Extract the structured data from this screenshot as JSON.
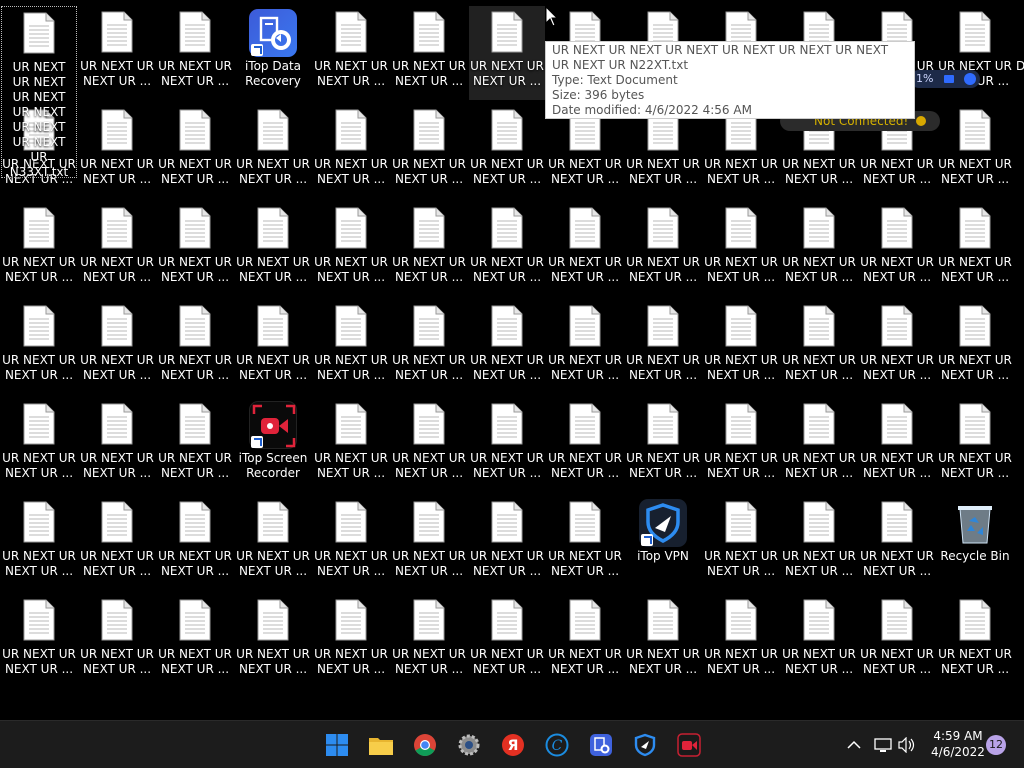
{
  "desktop": {
    "file_label": "UR NEXT UR NEXT UR ...",
    "selected_label": "UR NEXT UR NEXT UR NEXT UR NEXT UR NEXT UR NEXT UR N33XT.txt",
    "partial_label": "D",
    "apps": {
      "data_recovery": "iTop Data Recovery",
      "screen_recorder": "iTop Screen Recorder",
      "vpn": "iTop VPN",
      "recycle_bin": "Recycle Bin"
    }
  },
  "tooltip": {
    "name": "UR NEXT UR NEXT UR NEXT UR NEXT UR NEXT UR NEXT UR NEXT UR N22XT.txt",
    "type": "Type: Text Document",
    "size": "Size: 396 bytes",
    "modified": "Date modified: 4/6/2022 4:56 AM"
  },
  "overlays": {
    "status": "Not Connected!",
    "percent": "1%"
  },
  "taskbar": {
    "time": "4:59 AM",
    "date": "4/6/2022",
    "notifications": "12",
    "apps": [
      "windows-start",
      "file-explorer",
      "chrome",
      "settings",
      "yandex",
      "ccleaner",
      "itop-data-recovery",
      "itop-vpn",
      "itop-screen-recorder"
    ]
  },
  "colors": {
    "desktop_bg": "#000000",
    "taskbar_bg": "#1c1c1c",
    "windows_blue": "#2d8cf0",
    "yandex_red": "#e33022",
    "notification_badge": "#b9a3e8"
  }
}
